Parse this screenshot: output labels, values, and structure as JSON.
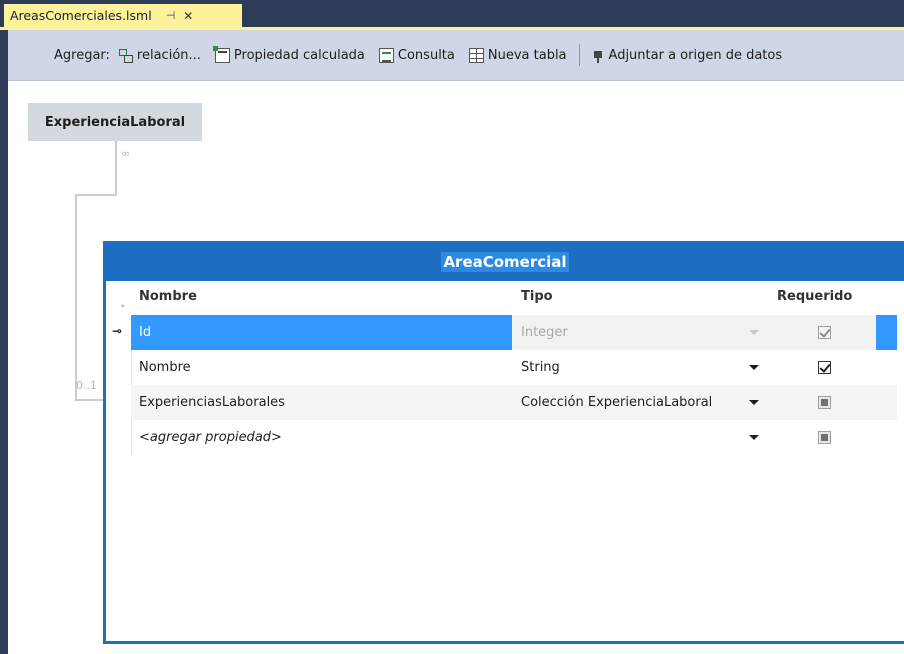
{
  "tab": {
    "title": "AreasComerciales.lsml",
    "pin_icon": "pin-icon",
    "close_glyph": "✕"
  },
  "toolbar": {
    "label": "Agregar:",
    "buttons": [
      {
        "label": "relación...",
        "icon": "relation-icon"
      },
      {
        "label": "Propiedad calculada",
        "icon": "calculated-property-icon"
      },
      {
        "label": "Consulta",
        "icon": "query-icon"
      },
      {
        "label": "Nueva tabla",
        "icon": "table-icon"
      },
      {
        "label": "Adjuntar a origen de datos",
        "icon": "attach-datasource-icon"
      }
    ]
  },
  "diagram": {
    "related_entity": "ExperienciaLaboral",
    "multiplicity_many": "∞",
    "multiplicity_one": "0..1"
  },
  "entity": {
    "title": "AreaComercial",
    "columns": {
      "name": "Nombre",
      "type": "Tipo",
      "required": "Requerido"
    },
    "rows": [
      {
        "name": "Id",
        "type": "Integer",
        "required": "checked-disabled",
        "key": true,
        "selected": true
      },
      {
        "name": "Nombre",
        "type": "String",
        "required": "checked"
      },
      {
        "name": "ExperienciasLaborales",
        "type": "Colección ExperienciaLaboral",
        "required": "indeterminate"
      },
      {
        "name": "<agregar propiedad>",
        "type": "",
        "required": "indeterminate",
        "placeholder": true
      }
    ]
  },
  "colors": {
    "accent": "#1c6fc0",
    "selection": "#3399ff",
    "tab": "#fff29d",
    "toolbar": "#cfd6e5"
  }
}
